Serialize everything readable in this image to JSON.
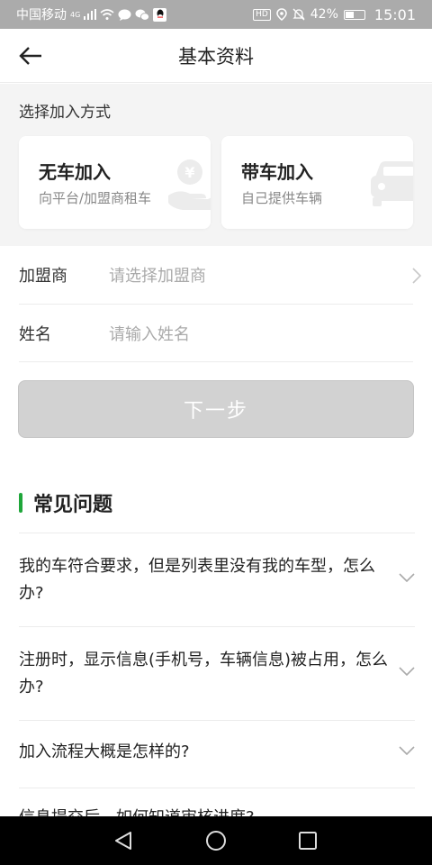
{
  "status_bar": {
    "carrier": "中国移动",
    "network": "4G",
    "battery": "42%",
    "time": "15:01",
    "hd_label": "HD",
    "icons": [
      "signal-icon",
      "wifi-icon",
      "message-icon",
      "wechat-icon",
      "qq-icon",
      "location-icon",
      "mute-icon",
      "battery-icon"
    ]
  },
  "nav": {
    "back_icon": "back-arrow-icon",
    "title": "基本资料"
  },
  "join": {
    "label": "选择加入方式",
    "options": [
      {
        "title": "无车加入",
        "subtitle": "向平台/加盟商租车",
        "icon": "yuan-hand-icon"
      },
      {
        "title": "带车加入",
        "subtitle": "自己提供车辆",
        "icon": "car-icon"
      }
    ]
  },
  "form": {
    "franchisee_label": "加盟商",
    "franchisee_placeholder": "请选择加盟商",
    "name_label": "姓名",
    "name_placeholder": "请输入姓名"
  },
  "next_button": "下一步",
  "faq": {
    "title": "常见问题",
    "accent_color": "#1fa63a",
    "items": [
      {
        "q": "我的车符合要求，但是列表里没有我的车型，怎么办?"
      },
      {
        "q": "注册时，显示信息(手机号，车辆信息)被占用，怎么办?"
      },
      {
        "q": "加入流程大概是怎样的?"
      },
      {
        "q": "信息提交后，如何知道审核进度?"
      }
    ]
  }
}
